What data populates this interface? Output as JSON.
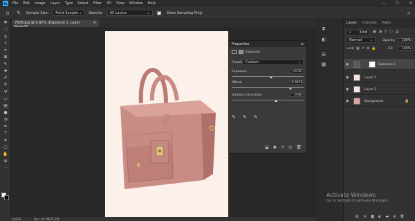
{
  "menu": [
    "File",
    "Edit",
    "Image",
    "Layer",
    "Type",
    "Select",
    "Filter",
    "3D",
    "View",
    "Window",
    "Help"
  ],
  "logo": "Ps",
  "options": {
    "sample_size_label": "Sample Size:",
    "sample_size_value": "Point Sample",
    "sample_label": "Sample:",
    "sample_value": "All Layers",
    "ring_label": "Show Sampling Ring"
  },
  "document": {
    "tab_title": "7829.jpg @ 9.92% (Exposure 1, Layer Mask/8)",
    "zoom": "9.92%",
    "doc_info": "Doc: 48.7M/75.2M"
  },
  "properties": {
    "title": "Properties",
    "adjustment": "Exposure",
    "preset_label": "Preset:",
    "preset_value": "Custom",
    "exposure_label": "Exposure:",
    "exposure_value": "+0.32",
    "exposure_pos": 0.55,
    "offset_label": "Offset:",
    "offset_value": "-0.0078",
    "offset_pos": 0.82,
    "gamma_label": "Gamma Correction:",
    "gamma_value": "0.94",
    "gamma_pos": 0.62
  },
  "layers": {
    "tabs": [
      "Layers",
      "Channels",
      "Paths"
    ],
    "kind_label": "Kind",
    "blend_mode": "Normal",
    "opacity_label": "Opacity:",
    "opacity_value": "100%",
    "lock_label": "Lock:",
    "fill_label": "Fill:",
    "fill_value": "100%",
    "items": [
      {
        "name": "Exposure 1"
      },
      {
        "name": "Layer 1"
      },
      {
        "name": "Layer 2"
      },
      {
        "name": "Background"
      }
    ]
  },
  "watermark": {
    "line1": "Activate Windows",
    "line2": "Go to Settings to activate Windows."
  },
  "colors": {
    "ps_blue": "#31a8ff",
    "bag_pink": "#c98c84",
    "canvas_bg": "#fbf0ea"
  }
}
